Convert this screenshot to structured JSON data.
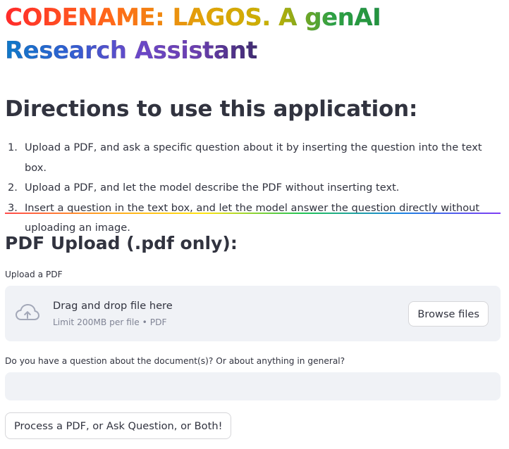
{
  "header": {
    "title_line1": "CODENAME: LAGOS. A genAI",
    "title_line2": "Research Assistant"
  },
  "directions": {
    "heading": "Directions to use this application:",
    "steps": [
      {
        "num": "1.",
        "text": "Upload a PDF, and ask a specific question about it by inserting the question into the text box."
      },
      {
        "num": "2.",
        "text": "Upload a PDF, and let the model describe the PDF without inserting text."
      },
      {
        "num": "3.",
        "text": "Insert a question in the text box, and let the model answer the question directly without uploading an image."
      }
    ]
  },
  "divider": {
    "colors": [
      "#ff4b4b",
      "#ffa421",
      "#ffe312",
      "#21c354",
      "#1c83e1",
      "#803df5"
    ]
  },
  "pdf_upload": {
    "heading": "PDF Upload (.pdf only):",
    "label": "Upload a PDF",
    "dropzone_text": "Drag and drop file here",
    "dropzone_limit": "Limit 200MB per file • PDF",
    "icon": "cloud-upload-icon",
    "browse_label": "Browse files"
  },
  "question": {
    "label": "Do you have a question about the document(s)? Or about anything in general?",
    "value": "",
    "placeholder": ""
  },
  "actions": {
    "process_label": "Process a PDF, or Ask Question, or Both!"
  },
  "colors": {
    "text": "#31333f",
    "muted": "#808495",
    "input_bg": "#f0f2f6",
    "border": "#d6d6d9"
  }
}
